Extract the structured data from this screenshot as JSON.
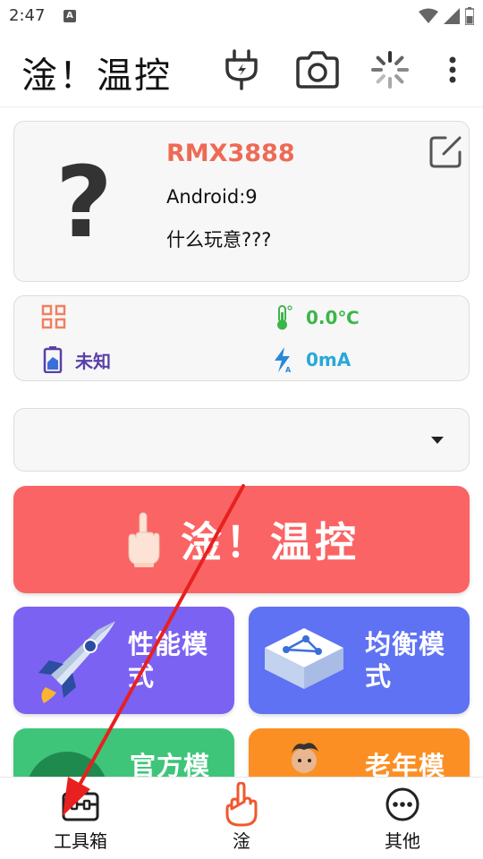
{
  "status_bar": {
    "time": "2:47",
    "notification_badge": "A"
  },
  "app_bar": {
    "title": "淦！温控",
    "actions": [
      "power-plug-icon",
      "camera-icon",
      "loading-spinner-icon",
      "more-vert-icon"
    ]
  },
  "device": {
    "placeholder_glyph": "?",
    "model": "RMX3888",
    "android": "Android:9",
    "description": "什么玩意???"
  },
  "stats": {
    "cpu_value": "",
    "temperature": "0.0℃",
    "battery_status": "未知",
    "current": "0mA"
  },
  "dropdown": {
    "selected": ""
  },
  "main_button": {
    "label": "淦！温控"
  },
  "modes": [
    {
      "label": "性能模式",
      "line1": "性能模",
      "line2": "式",
      "color": "#7c62f2"
    },
    {
      "label": "均衡模式",
      "line1": "均衡模",
      "line2": "式",
      "color": "#5f72f3"
    },
    {
      "label": "官方模",
      "line1": "官方模",
      "color": "#3fc57a"
    },
    {
      "label": "老年模",
      "line1": "老年模",
      "color": "#fb8f23"
    }
  ],
  "bottom_nav": {
    "toolbox": "工具箱",
    "gan": "淦",
    "other": "其他"
  },
  "colors": {
    "accent_red": "#fb6464",
    "model_orange": "#ee6a55",
    "temp_green": "#3cb64a",
    "battery_purple": "#5a3fa8",
    "current_cyan": "#2aa8d8",
    "arrow_red": "#e82020"
  }
}
